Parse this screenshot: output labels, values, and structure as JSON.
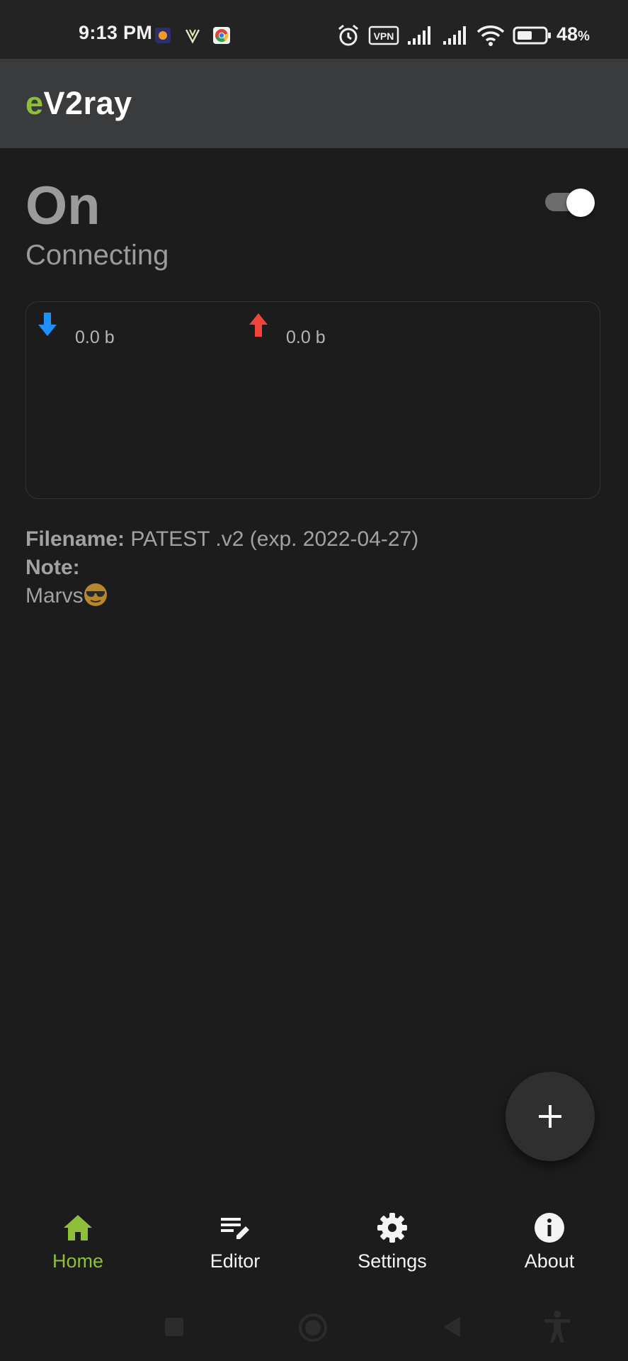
{
  "status_bar": {
    "time": "9:13 PM",
    "vpn": "VPN",
    "battery": "48",
    "battery_unit": "%",
    "icons": [
      "notification-app-icon",
      "notification-v-icon",
      "chrome-icon",
      "alarm-icon",
      "vpn-icon",
      "signal-icon",
      "signal-icon",
      "wifi-icon",
      "battery-icon"
    ]
  },
  "app_bar": {
    "title_accent": "e",
    "title_rest": "V2ray"
  },
  "connection": {
    "state": "On",
    "detail": "Connecting",
    "toggle_on": true
  },
  "traffic": {
    "download": "0.0 b",
    "upload": "0.0 b",
    "download_color": "#1e90ff",
    "upload_color": "#f0453a"
  },
  "info": {
    "filename_label": "Filename:",
    "filename_value": "PATEST .v2 (exp. 2022-04-27)",
    "note_label": "Note:",
    "note_value": "Marvs"
  },
  "fab": {
    "icon": "plus-icon"
  },
  "bottom_nav": {
    "items": [
      {
        "label": "Home",
        "icon": "home-icon",
        "active": true
      },
      {
        "label": "Editor",
        "icon": "edit-note-icon",
        "active": false
      },
      {
        "label": "Settings",
        "icon": "gear-icon",
        "active": false
      },
      {
        "label": "About",
        "icon": "info-icon",
        "active": false
      }
    ]
  },
  "colors": {
    "accent": "#8fbf3a",
    "background": "#1c1c1d",
    "app_bar": "#3a3b3d"
  }
}
